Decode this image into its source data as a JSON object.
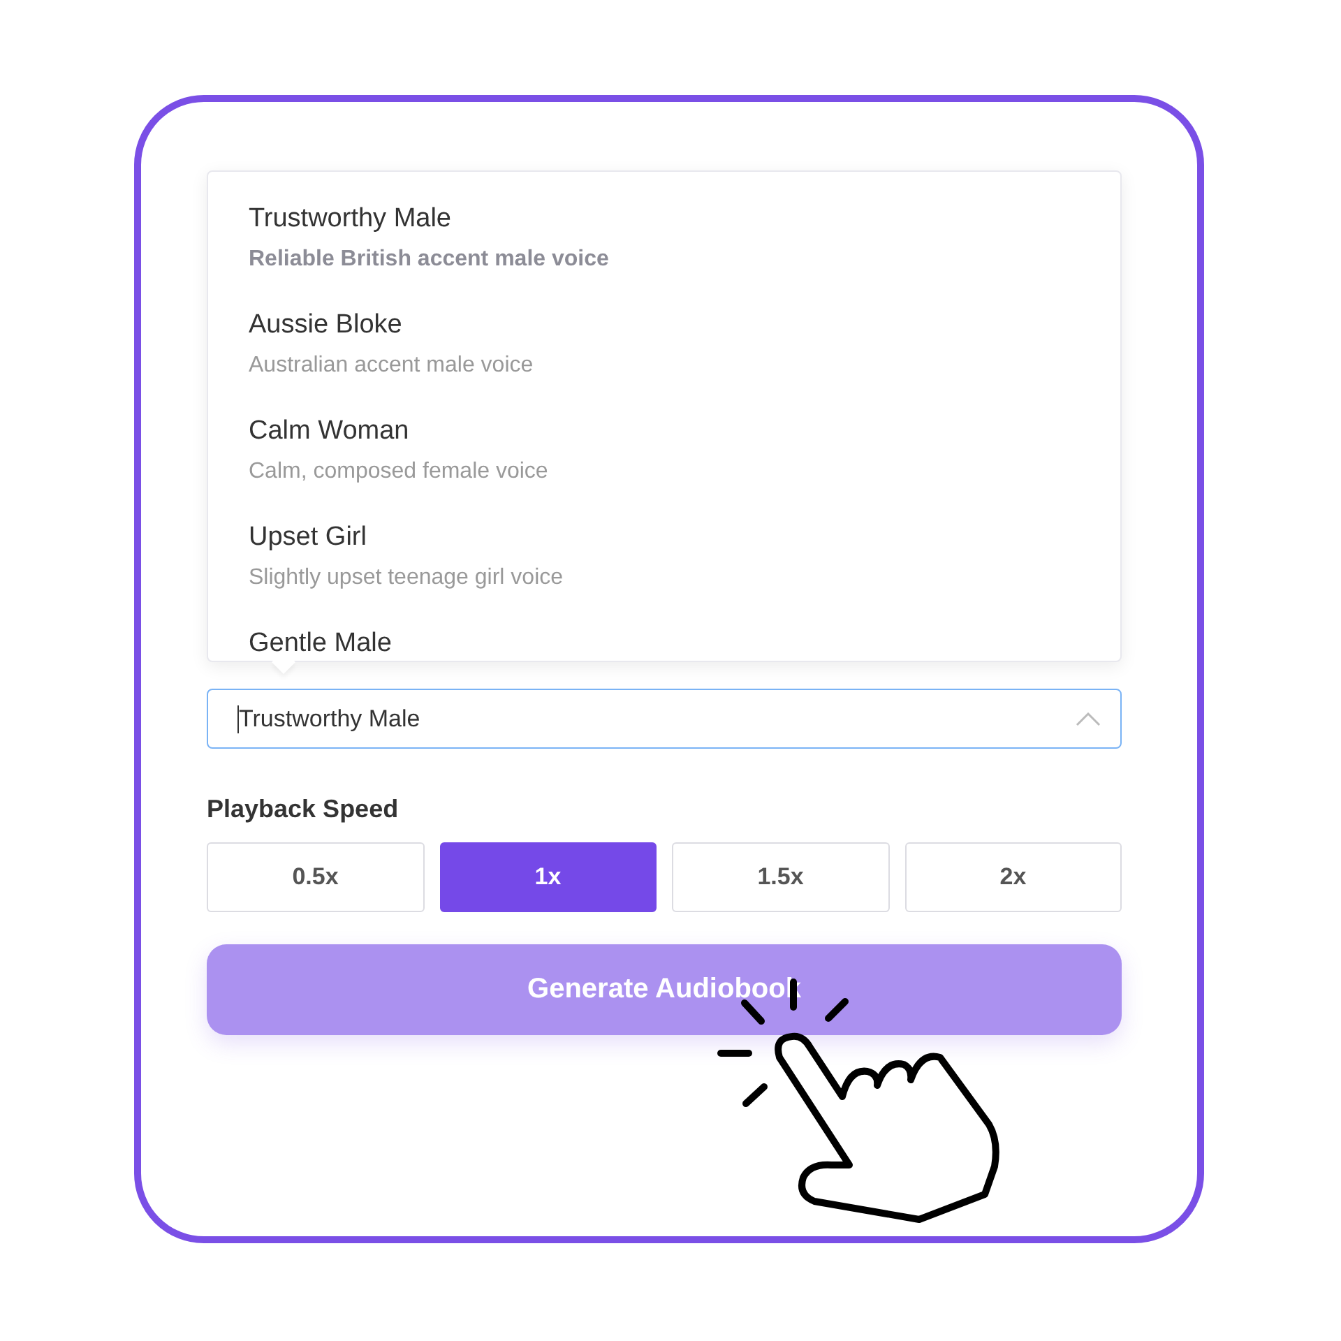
{
  "voice_dropdown": {
    "options": [
      {
        "name": "Trustworthy Male",
        "description": "Reliable British accent male voice",
        "selected": true
      },
      {
        "name": "Aussie Bloke",
        "description": "Australian accent male voice",
        "selected": false
      },
      {
        "name": "Calm Woman",
        "description": "Calm, composed female voice",
        "selected": false
      },
      {
        "name": "Upset Girl",
        "description": "Slightly upset teenage girl voice",
        "selected": false
      },
      {
        "name": "Gentle Male",
        "selected": false
      }
    ]
  },
  "voice_select": {
    "value": "Trustworthy Male",
    "expanded": true,
    "focused": true
  },
  "playback_speed": {
    "label": "Playback Speed",
    "options": [
      {
        "label": "0.5x",
        "selected": false
      },
      {
        "label": "1x",
        "selected": true
      },
      {
        "label": "1.5x",
        "selected": false
      },
      {
        "label": "2x",
        "selected": false
      }
    ]
  },
  "generate_button": {
    "label": "Generate Audiobook"
  }
}
